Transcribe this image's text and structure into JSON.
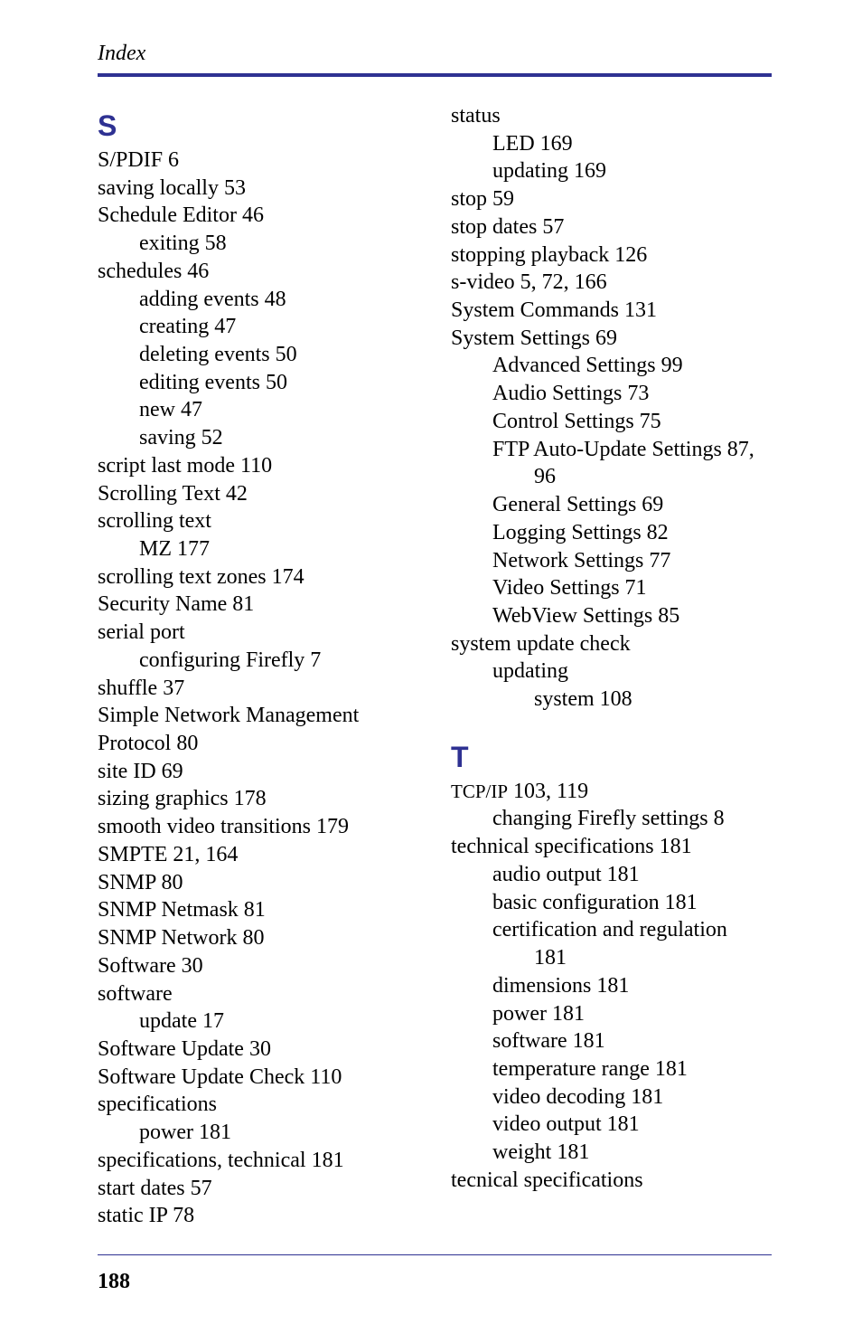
{
  "running_head": "Index",
  "page_number": "188",
  "left": {
    "letter": "S",
    "entries": [
      {
        "lvl": 0,
        "text": "S/PDIF 6"
      },
      {
        "lvl": 0,
        "text": "saving locally 53"
      },
      {
        "lvl": 0,
        "text": "Schedule Editor 46"
      },
      {
        "lvl": 1,
        "text": "exiting 58"
      },
      {
        "lvl": 0,
        "text": "schedules 46"
      },
      {
        "lvl": 1,
        "text": "adding events 48"
      },
      {
        "lvl": 1,
        "text": "creating 47"
      },
      {
        "lvl": 1,
        "text": "deleting events 50"
      },
      {
        "lvl": 1,
        "text": "editing events 50"
      },
      {
        "lvl": 1,
        "text": "new 47"
      },
      {
        "lvl": 1,
        "text": "saving 52"
      },
      {
        "lvl": 0,
        "text": "script last mode 110"
      },
      {
        "lvl": 0,
        "text": "Scrolling Text 42"
      },
      {
        "lvl": 0,
        "text": "scrolling text"
      },
      {
        "lvl": 1,
        "text": "MZ 177"
      },
      {
        "lvl": 0,
        "text": "scrolling text zones 174"
      },
      {
        "lvl": 0,
        "text": "Security Name 81"
      },
      {
        "lvl": 0,
        "text": "serial port"
      },
      {
        "lvl": 1,
        "text": "configuring Firefly 7"
      },
      {
        "lvl": 0,
        "text": "shuffle 37"
      },
      {
        "lvl": 0,
        "text": "Simple Network Management Protocol 80"
      },
      {
        "lvl": 0,
        "text": "site ID 69"
      },
      {
        "lvl": 0,
        "text": "sizing graphics 178"
      },
      {
        "lvl": 0,
        "text": "smooth video transitions 179"
      },
      {
        "lvl": 0,
        "text": "SMPTE 21, 164"
      },
      {
        "lvl": 0,
        "text": "SNMP 80"
      },
      {
        "lvl": 0,
        "text": "SNMP Netmask 81"
      },
      {
        "lvl": 0,
        "text": "SNMP Network 80"
      },
      {
        "lvl": 0,
        "text": "Software 30"
      },
      {
        "lvl": 0,
        "text": "software"
      },
      {
        "lvl": 1,
        "text": "update 17"
      },
      {
        "lvl": 0,
        "text": "Software Update 30"
      },
      {
        "lvl": 0,
        "text": "Software Update Check 110"
      },
      {
        "lvl": 0,
        "text": "specifications"
      },
      {
        "lvl": 1,
        "text": "power 181"
      },
      {
        "lvl": 0,
        "text": "specifications, technical 181"
      },
      {
        "lvl": 0,
        "text": "start dates 57"
      },
      {
        "lvl": 0,
        "text": "static IP 78"
      }
    ]
  },
  "right": {
    "block1": [
      {
        "lvl": 0,
        "text": "status"
      },
      {
        "lvl": 1,
        "text": "LED 169"
      },
      {
        "lvl": 1,
        "text": "updating 169"
      },
      {
        "lvl": 0,
        "text": "stop 59"
      },
      {
        "lvl": 0,
        "text": "stop dates 57"
      },
      {
        "lvl": 0,
        "text": "stopping playback 126"
      },
      {
        "lvl": 0,
        "text": "s-video 5, 72, 166"
      },
      {
        "lvl": 0,
        "text": "System Commands 131"
      },
      {
        "lvl": 0,
        "text": "System Settings 69"
      },
      {
        "lvl": 1,
        "text": "Advanced Settings 99"
      },
      {
        "lvl": 1,
        "text": "Audio Settings 73"
      },
      {
        "lvl": 1,
        "text": "Control Settings 75"
      },
      {
        "lvl": 1,
        "text": "FTP Auto-Update Settings 87, "
      },
      {
        "lvl": 2,
        "text": "96"
      },
      {
        "lvl": 1,
        "text": "General Settings 69"
      },
      {
        "lvl": 1,
        "text": "Logging Settings 82"
      },
      {
        "lvl": 1,
        "text": "Network Settings 77"
      },
      {
        "lvl": 1,
        "text": "Video Settings 71"
      },
      {
        "lvl": 1,
        "text": "WebView Settings 85"
      },
      {
        "lvl": 0,
        "text": "system update check"
      },
      {
        "lvl": 1,
        "text": "updating"
      },
      {
        "lvl": 2,
        "text": "system 108"
      }
    ],
    "letter": "T",
    "block2_first_prefix": "TCP/IP",
    "block2_first_rest": " 103, 119",
    "block2": [
      {
        "lvl": 1,
        "text": "changing Firefly settings 8"
      },
      {
        "lvl": 0,
        "text": "technical specifications 181"
      },
      {
        "lvl": 1,
        "text": "audio output 181"
      },
      {
        "lvl": 1,
        "text": "basic configuration 181"
      },
      {
        "lvl": 1,
        "text": "certification and regulation "
      },
      {
        "lvl": 2,
        "text": "181"
      },
      {
        "lvl": 1,
        "text": "dimensions 181"
      },
      {
        "lvl": 1,
        "text": "power 181"
      },
      {
        "lvl": 1,
        "text": "software 181"
      },
      {
        "lvl": 1,
        "text": "temperature range 181"
      },
      {
        "lvl": 1,
        "text": "video decoding 181"
      },
      {
        "lvl": 1,
        "text": "video output 181"
      },
      {
        "lvl": 1,
        "text": "weight 181"
      },
      {
        "lvl": 0,
        "text": "tecnical specifications"
      }
    ]
  }
}
